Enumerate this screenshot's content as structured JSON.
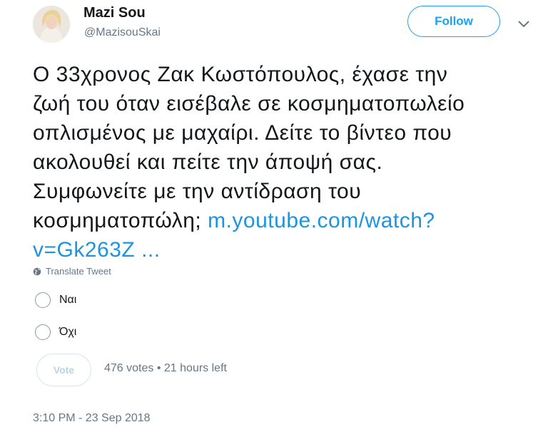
{
  "user": {
    "name": "Mazi Sou",
    "handle": "@MazisouSkai",
    "follow_label": "Follow"
  },
  "tweet": {
    "lines": [
      "Ο 33χρονος Ζακ Κωστόπουλος, έχασε την",
      "ζωή του όταν εισέβαλε σε κοσμηματοπωλείο",
      "οπλισμένος με μαχαίρι. Δείτε το βίντεο που",
      "ακολουθεί και πείτε την άποψή σας.",
      "Συμφωνείτε με την αντίδραση του",
      "κοσμηματοπώλη;"
    ],
    "link_part1": "m.youtube.com/watch?",
    "link_part2": "v=Gk263Z ...",
    "translate_label": "Translate Tweet"
  },
  "poll": {
    "options": [
      "Ναι",
      "Όχι"
    ],
    "vote_label": "Vote",
    "votes": "476 votes",
    "separator": "•",
    "time_left": "21 hours left"
  },
  "timestamp": "3:10 PM - 23 Sep 2018",
  "colors": {
    "accent": "#1da1f2",
    "link": "#1b95e0",
    "secondary_text": "#657786",
    "primary_text": "#14171a"
  },
  "icons": {
    "dropdown": "chevron-down-icon",
    "translate": "globe-icon"
  }
}
